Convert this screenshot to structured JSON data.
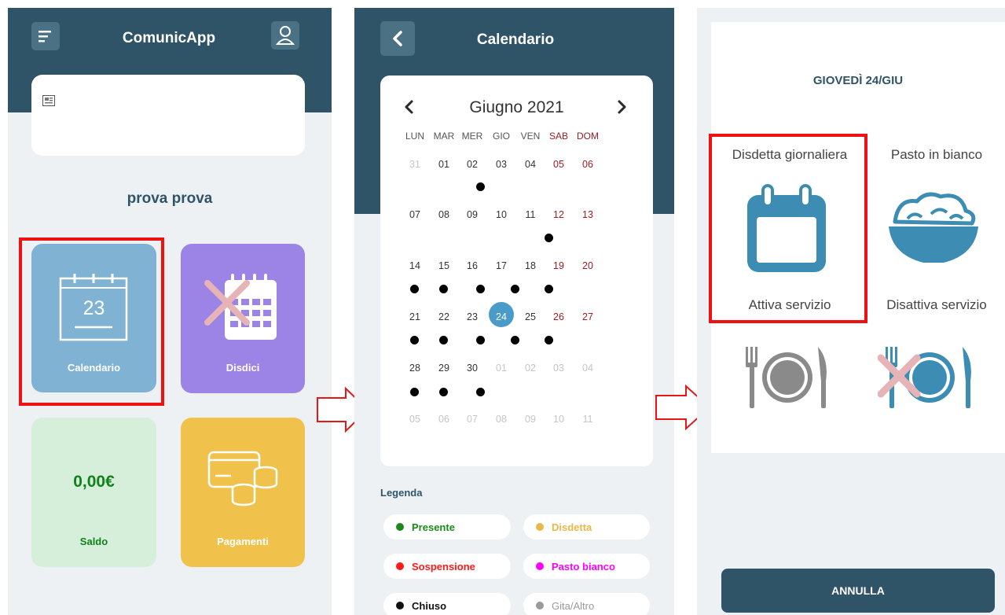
{
  "screen1": {
    "app_title": "ComunicApp",
    "user_name": "prova prova",
    "tiles": {
      "calendario": {
        "label": "Calendario",
        "day_number": "23",
        "color": "#7fb2d3"
      },
      "disdici": {
        "label": "Disdici",
        "color": "#9c83e6"
      },
      "saldo": {
        "label": "Saldo",
        "value": "0,00€",
        "color": "#d5efdb"
      },
      "pagamenti": {
        "label": "Pagamenti",
        "color": "#f0c24b"
      }
    }
  },
  "screen2": {
    "title": "Calendario",
    "month_label": "Giugno 2021",
    "weekdays": [
      "LUN",
      "MAR",
      "MER",
      "GIO",
      "VEN",
      "SAB",
      "DOM"
    ],
    "weeks": [
      [
        "31",
        "01",
        "02",
        "03",
        "04",
        "05",
        "06"
      ],
      [
        "07",
        "08",
        "09",
        "10",
        "11",
        "12",
        "13"
      ],
      [
        "14",
        "15",
        "16",
        "17",
        "18",
        "19",
        "20"
      ],
      [
        "21",
        "22",
        "23",
        "24",
        "25",
        "26",
        "27"
      ],
      [
        "28",
        "29",
        "30",
        "01",
        "02",
        "03",
        "04"
      ],
      [
        "05",
        "06",
        "07",
        "08",
        "09",
        "10",
        "11"
      ]
    ],
    "selected_day": "24",
    "legend_title": "Legenda",
    "legend": [
      {
        "label": "Presente",
        "color": "#1b8a1b"
      },
      {
        "label": "Disdetta",
        "color": "#e8b84a"
      },
      {
        "label": "Sospensione",
        "color": "#ff1a1a"
      },
      {
        "label": "Pasto bianco",
        "color": "#ff00ff"
      },
      {
        "label": "Chiuso",
        "color": "#111111"
      },
      {
        "label": "Gita/Altro",
        "color": "#9a9a9a"
      }
    ]
  },
  "screen3": {
    "date_title": "GIOVEDÌ 24/GIU",
    "options": {
      "disdetta": "Disdetta giornaliera",
      "pasto_bianco": "Pasto in bianco",
      "attiva": "Attiva servizio",
      "disattiva": "Disattiva servizio"
    },
    "cancel_label": "ANNULLA"
  },
  "colors": {
    "header": "#2f5468",
    "icon_blue": "#3d8cb3",
    "highlight": "#ee1111"
  }
}
